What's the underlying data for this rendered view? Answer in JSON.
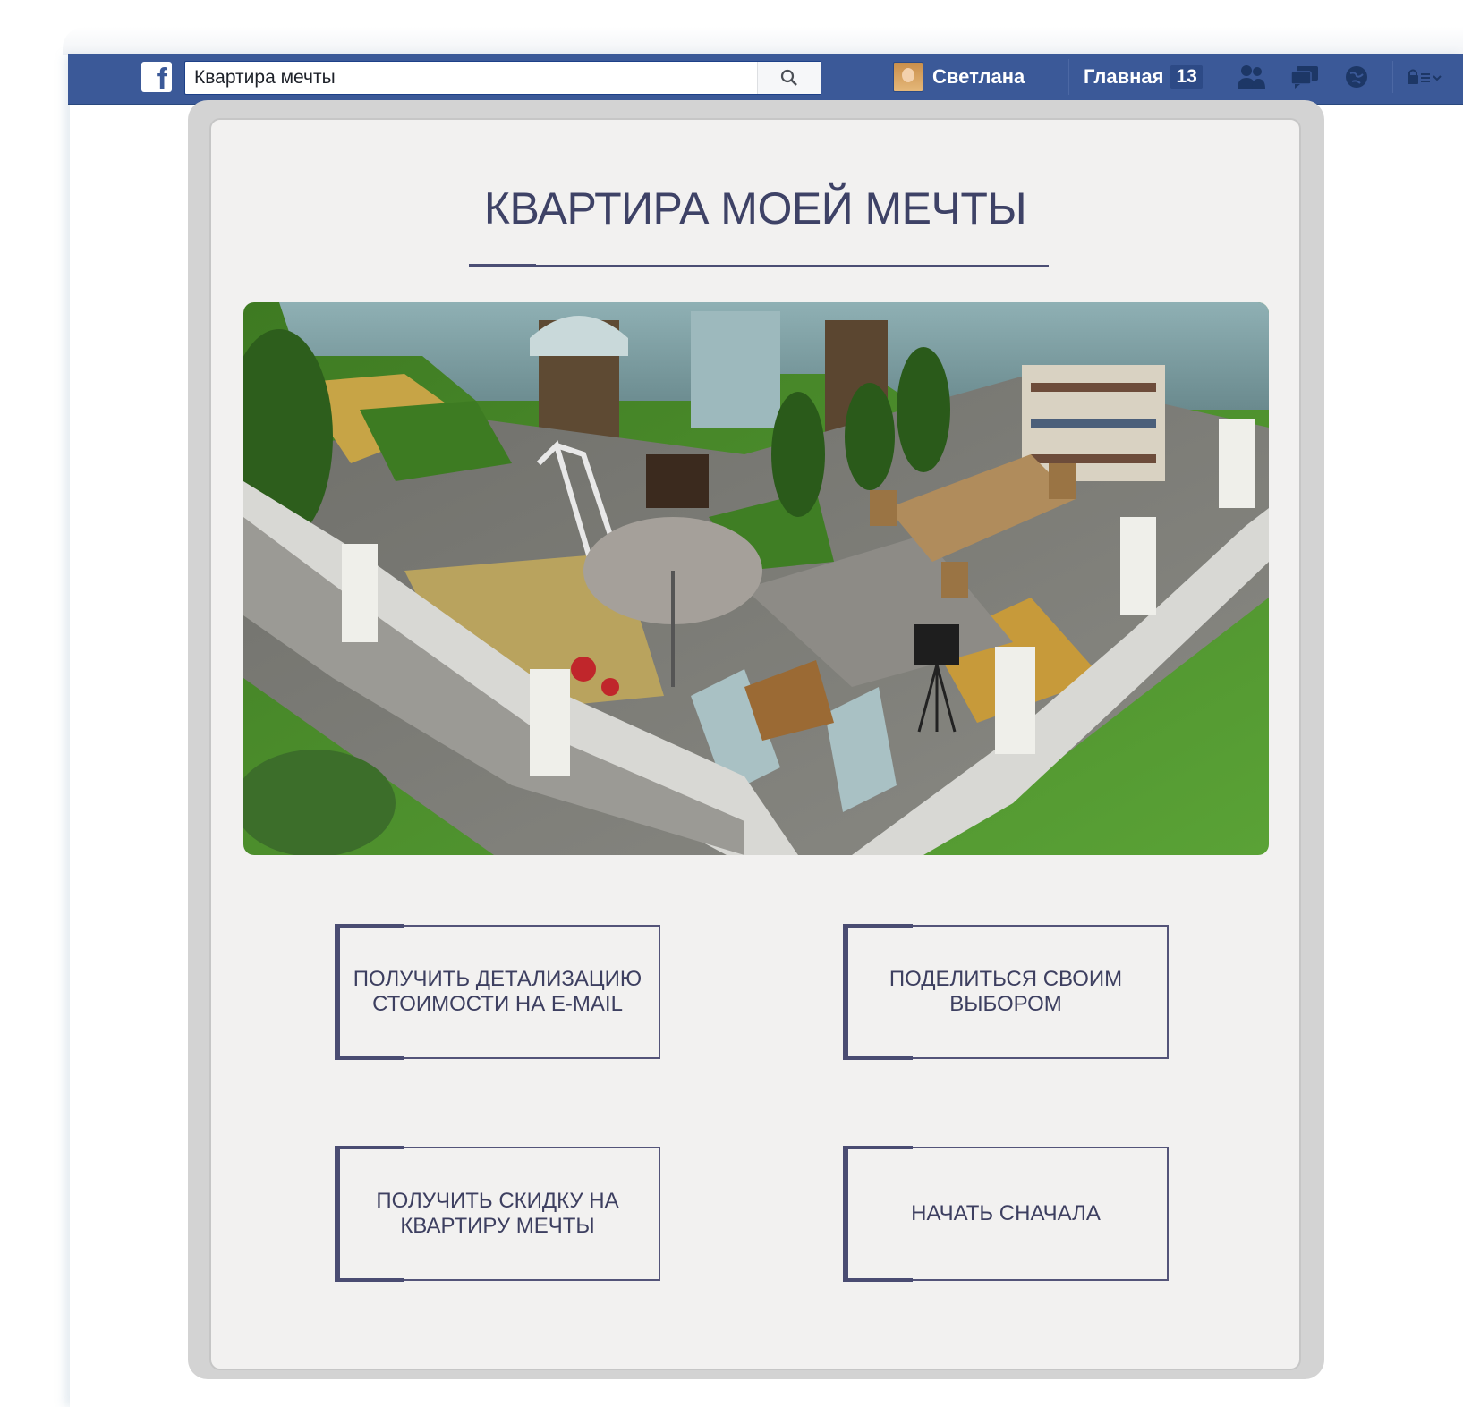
{
  "fb_bar": {
    "search_value": "Квартира мечты",
    "user_name": "Светлана",
    "home_label": "Главная",
    "home_count": "13"
  },
  "app": {
    "title": "КВАРТИРА МОЕЙ МЕЧТЫ",
    "buttons": [
      "ПОЛУЧИТЬ ДЕТАЛИЗАЦИЮ СТОИМОСТИ НА E-MAIL",
      "ПОДЕЛИТЬСЯ СВОИМ ВЫБОРОМ",
      "ПОЛУЧИТЬ СКИДКУ НА КВАРТИРУ МЕЧТЫ",
      "НАЧАТЬ СНАЧАЛА"
    ]
  },
  "colors": {
    "fb_blue": "#3b5998",
    "accent_navy": "#4a4c72",
    "panel_bg": "#f2f1f0"
  }
}
